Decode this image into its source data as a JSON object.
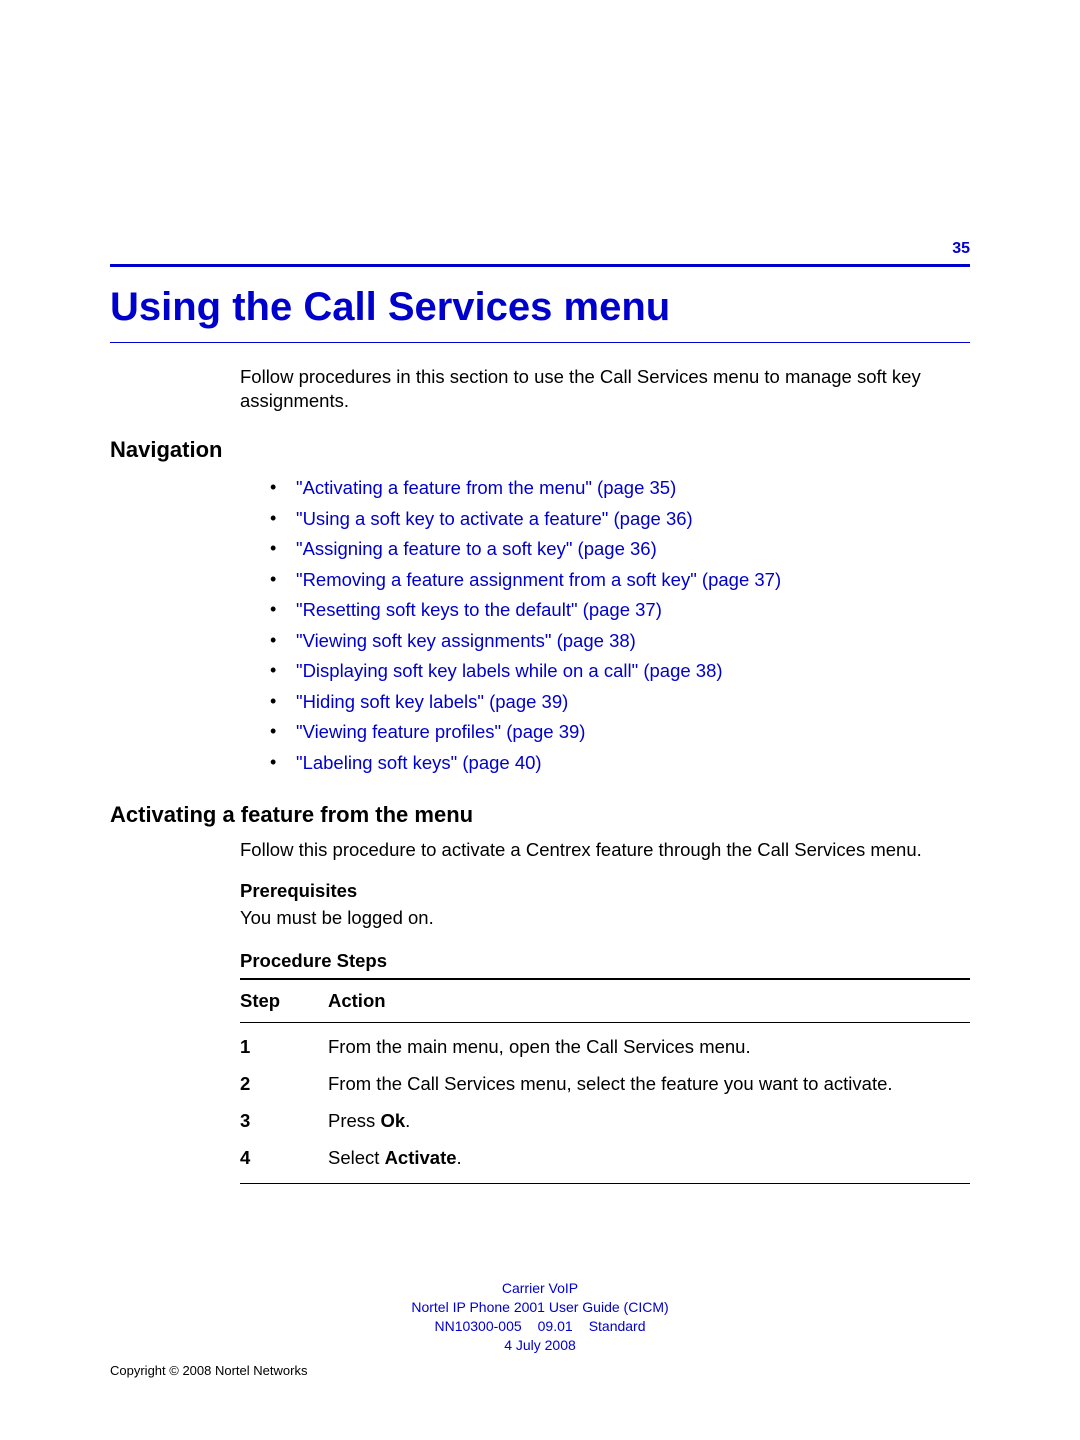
{
  "page_number": "35",
  "chapter_title": "Using the Call Services menu",
  "intro_text": "Follow procedures in this section to use the Call Services menu to manage soft key assignments.",
  "navigation": {
    "heading": "Navigation",
    "items": [
      "\"Activating a feature from the menu\" (page 35)",
      "\"Using a soft key to activate a feature\" (page 36)",
      "\"Assigning a feature to a soft key\" (page 36)",
      "\"Removing a feature assignment from a soft key\" (page 37)",
      "\"Resetting soft keys to the default\" (page 37)",
      "\"Viewing soft key assignments\" (page 38)",
      "\"Displaying soft key labels while on a call\" (page 38)",
      "\"Hiding soft key labels\" (page 39)",
      "\"Viewing feature profiles\" (page 39)",
      "\"Labeling soft keys\" (page 40)"
    ]
  },
  "section2": {
    "heading": "Activating a feature from the menu",
    "intro": "Follow this procedure to activate a Centrex feature through the Call Services menu.",
    "prereq_heading": "Prerequisites",
    "prereq_body": "You must be logged on.",
    "steps_heading": "Procedure Steps",
    "table_header_step": "Step",
    "table_header_action": "Action",
    "rows": [
      {
        "num": "1",
        "action_pre": "From the main menu, open the Call Services menu.",
        "bold": "",
        "action_post": ""
      },
      {
        "num": "2",
        "action_pre": "From the Call Services menu, select the feature you want to activate.",
        "bold": "",
        "action_post": ""
      },
      {
        "num": "3",
        "action_pre": "Press ",
        "bold": "Ok",
        "action_post": "."
      },
      {
        "num": "4",
        "action_pre": "Select ",
        "bold": "Activate",
        "action_post": "."
      }
    ]
  },
  "footer": {
    "line1": "Carrier VoIP",
    "line2": "Nortel IP Phone 2001 User Guide (CICM)",
    "line3a": "NN10300-005",
    "line3b": "09.01",
    "line3c": "Standard",
    "line4": "4 July 2008",
    "copyright": "Copyright © 2008 Nortel Networks"
  }
}
